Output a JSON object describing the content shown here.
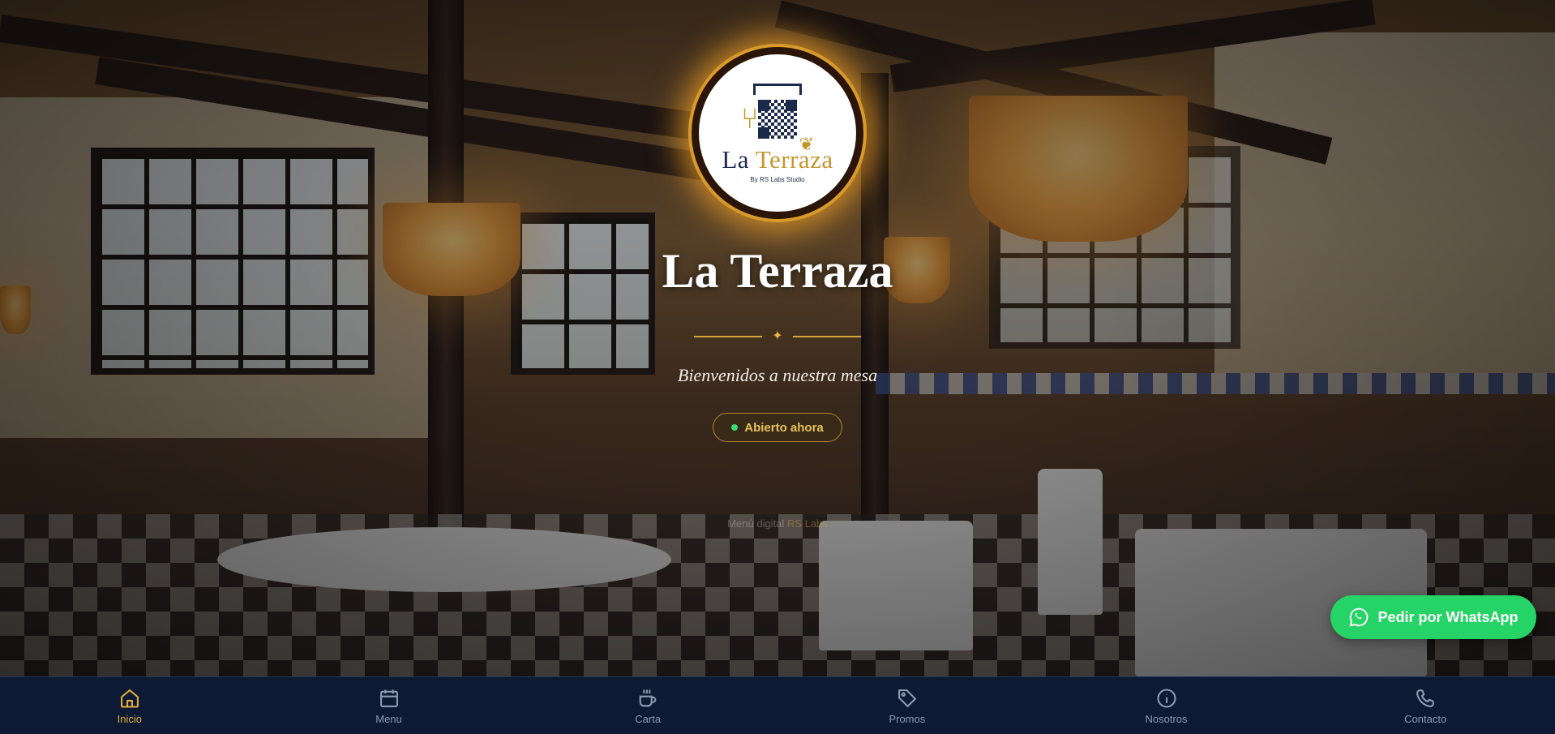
{
  "logo": {
    "brand_first": "La",
    "brand_second": "Terraza",
    "byline": "By RS Labs Studio"
  },
  "hero": {
    "title": "La Terraza",
    "subtitle": "Bienvenidos a nuestra mesa",
    "status": "Abierto ahora",
    "credit_prefix": "Menú digital ",
    "credit_link": "RS Labs"
  },
  "whatsapp": {
    "label": "Pedir por WhatsApp",
    "icon": "whatsapp-icon"
  },
  "nav": {
    "items": [
      {
        "label": "Inicio",
        "icon": "home-icon",
        "active": true
      },
      {
        "label": "Menu",
        "icon": "calendar-icon",
        "active": false
      },
      {
        "label": "Carta",
        "icon": "coffee-icon",
        "active": false
      },
      {
        "label": "Promos",
        "icon": "tag-icon",
        "active": false
      },
      {
        "label": "Nosotros",
        "icon": "info-icon",
        "active": false
      },
      {
        "label": "Contacto",
        "icon": "phone-icon",
        "active": false
      }
    ]
  },
  "colors": {
    "accent": "#e0ac3c",
    "nav_bg": "#0c1a33",
    "whatsapp": "#25d366",
    "status_dot": "#3ddc6e"
  }
}
